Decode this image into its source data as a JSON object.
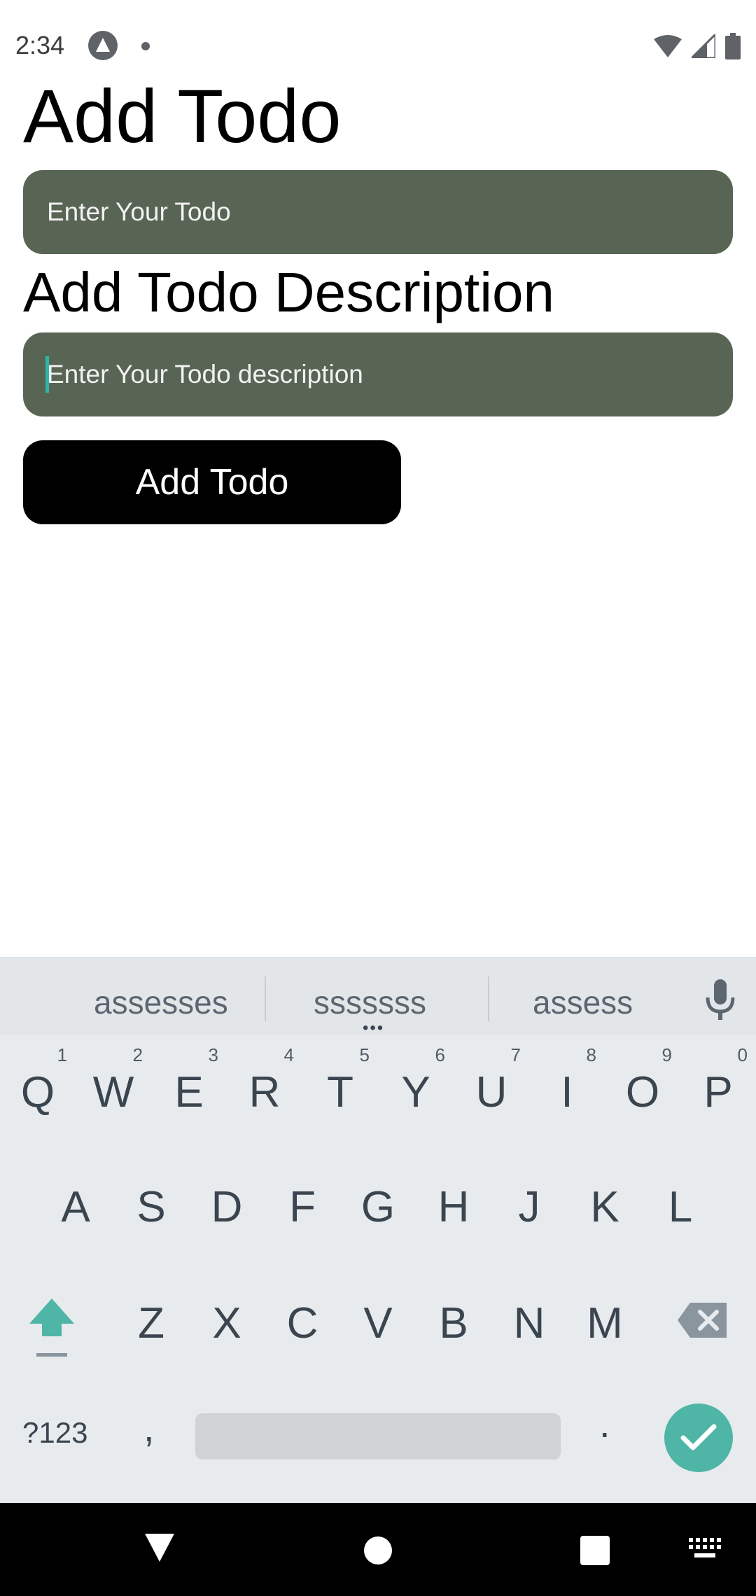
{
  "status_bar": {
    "time": "2:34"
  },
  "screen": {
    "title": "Add Todo",
    "todo_input_placeholder": "Enter Your Todo",
    "description_title": "Add Todo Description",
    "description_input_placeholder": "Enter Your Todo description",
    "add_button_label": "Add Todo"
  },
  "keyboard": {
    "suggestions": [
      "assesses",
      "sssssss",
      "assess"
    ],
    "row1": [
      {
        "key": "Q",
        "hint": "1"
      },
      {
        "key": "W",
        "hint": "2"
      },
      {
        "key": "E",
        "hint": "3"
      },
      {
        "key": "R",
        "hint": "4"
      },
      {
        "key": "T",
        "hint": "5"
      },
      {
        "key": "Y",
        "hint": "6"
      },
      {
        "key": "U",
        "hint": "7"
      },
      {
        "key": "I",
        "hint": "8"
      },
      {
        "key": "O",
        "hint": "9"
      },
      {
        "key": "P",
        "hint": "0"
      }
    ],
    "row2": [
      "A",
      "S",
      "D",
      "F",
      "G",
      "H",
      "J",
      "K",
      "L"
    ],
    "row3": [
      "Z",
      "X",
      "C",
      "V",
      "B",
      "N",
      "M"
    ],
    "symbols_label": "?123",
    "comma_label": ",",
    "period_label": ".",
    "accent_color": "#4fb5a6"
  },
  "colors": {
    "input_background": "#586555",
    "button_background": "#000000",
    "caret": "#2bb8a8"
  }
}
